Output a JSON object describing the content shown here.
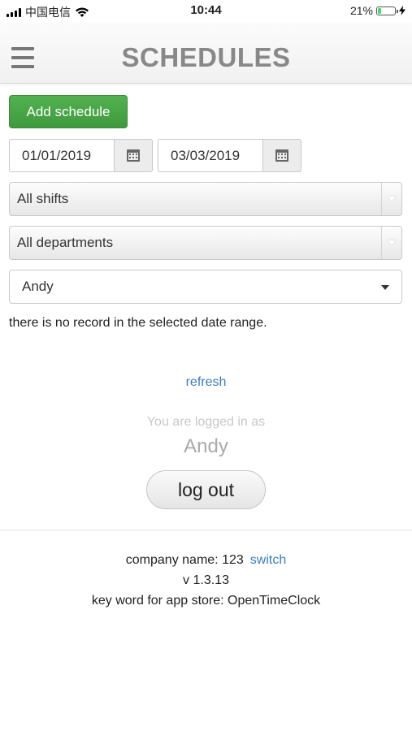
{
  "status_bar": {
    "carrier": "中国电信",
    "time": "10:44",
    "battery_percent": "21%",
    "battery_level": 0.21,
    "battery_color": "#4cd964"
  },
  "header": {
    "title": "SCHEDULES",
    "menu_icon": "hamburger-menu-icon"
  },
  "form": {
    "add_button_label": "Add schedule",
    "add_button_color": "#46a443",
    "start_date": "01/01/2019",
    "end_date": "03/03/2019",
    "calendar_icon": "calendar-icon",
    "shift_select": "All shifts",
    "department_select": "All departments",
    "employee_select": "Andy"
  },
  "message": "there is no record in the selected date range.",
  "refresh_label": "refresh",
  "session": {
    "logged_in_text": "You are logged in as",
    "username": "Andy",
    "logout_label": "log out"
  },
  "footer": {
    "company_label": "company name: 123",
    "switch_label": "switch",
    "version": "v 1.3.13",
    "keyword": "key word for app store: OpenTimeClock"
  },
  "colors": {
    "link": "#3a7dbf",
    "title": "#888888"
  }
}
